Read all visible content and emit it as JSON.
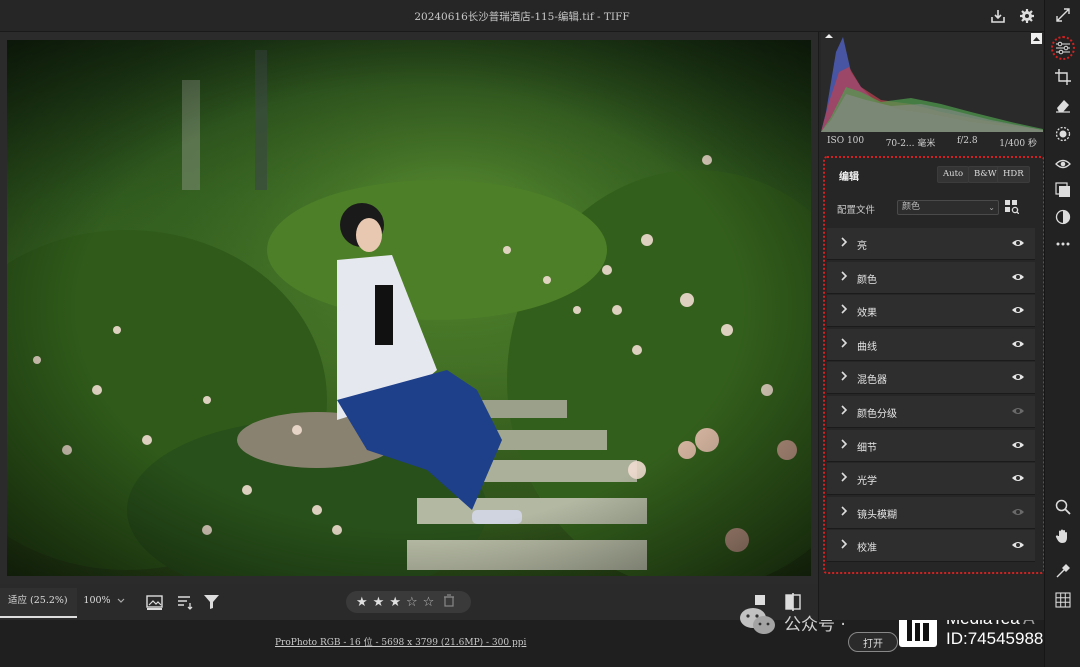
{
  "window": {
    "title": "20240616长沙普瑞酒店-115-编辑.tif -  TIFF"
  },
  "bottom_toolbar": {
    "zoom_fit": "适应 (25.2%)",
    "zoom_100": "100%",
    "rating_stars": 3,
    "rating_max": 5
  },
  "status": {
    "file_info": "ProPhoto RGB - 16 位 - 5698 x 3799 (21.6MP) - 300 ppi",
    "open_label": "打开"
  },
  "histogram": {
    "iso": "ISO 100",
    "lens": "70-2... 毫米",
    "aperture": "f/2.8",
    "shutter": "1/400 秒"
  },
  "edit_panel": {
    "title": "编辑",
    "auto_label": "Auto",
    "bw_label": "B&W",
    "hdr_label": "HDR",
    "profile_label": "配置文件",
    "profile_value": "颜色",
    "sections": [
      {
        "label": "亮",
        "visible": true
      },
      {
        "label": "颜色",
        "visible": true
      },
      {
        "label": "效果",
        "visible": true
      },
      {
        "label": "曲线",
        "visible": true
      },
      {
        "label": "混色器",
        "visible": true
      },
      {
        "label": "颜色分级",
        "visible": false
      },
      {
        "label": "细节",
        "visible": true
      },
      {
        "label": "光学",
        "visible": true
      },
      {
        "label": "镜头模糊",
        "visible": false
      },
      {
        "label": "校准",
        "visible": true
      }
    ]
  },
  "watermark": {
    "wechat_text": "公众号 ·",
    "brand": "MediaTea",
    "id": "ID:74545988",
    "ghost": "A"
  },
  "colors": {
    "accent_red": "#d42020",
    "panel": "#262626",
    "section": "#2e2e2e"
  }
}
